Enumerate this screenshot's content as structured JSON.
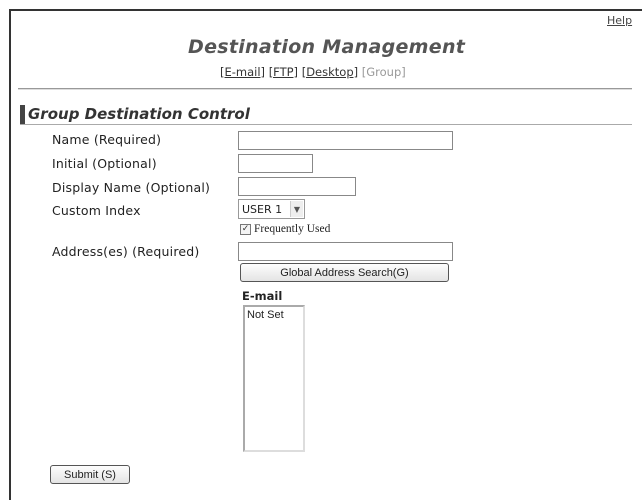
{
  "header": {
    "help_link": "Help",
    "title": "Destination Management",
    "nav": [
      {
        "label": "[E-mail]",
        "active": false
      },
      {
        "label": "[FTP]",
        "active": false
      },
      {
        "label": "[Desktop]",
        "active": false
      },
      {
        "label": "[Group]",
        "active": true
      }
    ]
  },
  "section": {
    "title": "Group Destination Control"
  },
  "form": {
    "name_label": "Name (Required)",
    "name_value": "",
    "initial_label": "Initial (Optional)",
    "initial_value": "",
    "display_name_label": "Display Name (Optional)",
    "display_name_value": "",
    "custom_index_label": "Custom Index",
    "custom_index_value": "USER 1",
    "frequently_used_label": "Frequently Used",
    "frequently_used_checked": true,
    "addresses_label": "Address(es) (Required)",
    "addresses_value": "",
    "global_search_button": "Global Address Search(G)",
    "email_list_header": "E-mail",
    "email_list_items": [
      "Not Set"
    ],
    "submit_button": "Submit (S)"
  }
}
